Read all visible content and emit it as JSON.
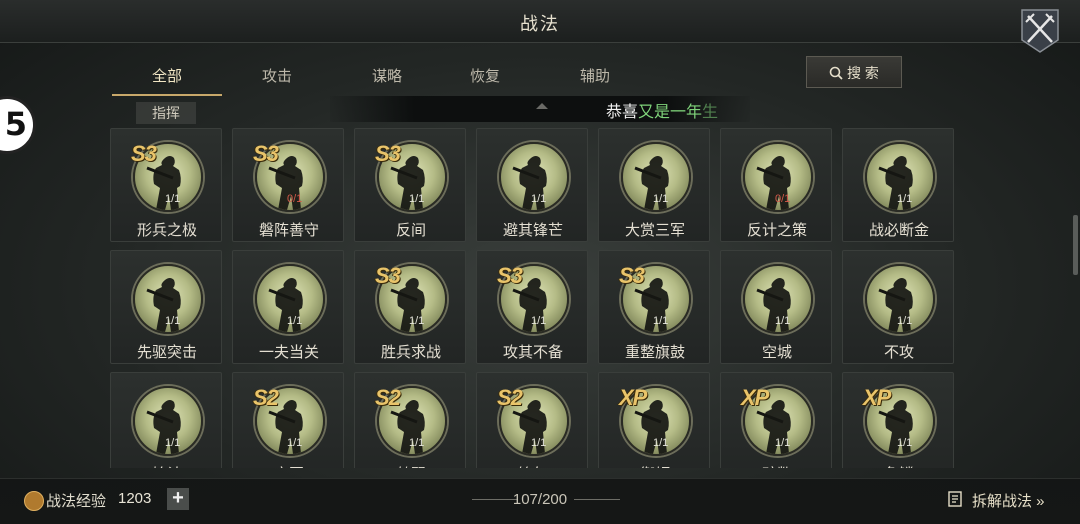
{
  "header": {
    "title": "战法"
  },
  "left_avatar": {
    "text": "5"
  },
  "tabs": [
    {
      "label": "全部",
      "active": true
    },
    {
      "label": "攻击",
      "active": false
    },
    {
      "label": "谋略",
      "active": false
    },
    {
      "label": "恢复",
      "active": false
    },
    {
      "label": "辅助",
      "active": false
    }
  ],
  "subtab": {
    "label": "指挥"
  },
  "search": {
    "label": "搜 索"
  },
  "banner": {
    "text_a": "恭喜",
    "text_b": "又是一年",
    "text_c": "生"
  },
  "cards": [
    {
      "grade": "S3",
      "count": "1/1",
      "count_red": false,
      "name": "形兵之极"
    },
    {
      "grade": "S3",
      "count": "0/1",
      "count_red": true,
      "name": "磐阵善守"
    },
    {
      "grade": "S3",
      "count": "1/1",
      "count_red": false,
      "name": "反间"
    },
    {
      "grade": "",
      "count": "1/1",
      "count_red": false,
      "name": "避其锋芒"
    },
    {
      "grade": "",
      "count": "1/1",
      "count_red": false,
      "name": "大赏三军"
    },
    {
      "grade": "",
      "count": "0/1",
      "count_red": true,
      "name": "反计之策"
    },
    {
      "grade": "",
      "count": "1/1",
      "count_red": false,
      "name": "战必断金"
    },
    {
      "grade": "",
      "count": "1/1",
      "count_red": false,
      "name": "先驱突击"
    },
    {
      "grade": "",
      "count": "1/1",
      "count_red": false,
      "name": "一夫当关"
    },
    {
      "grade": "S3",
      "count": "1/1",
      "count_red": false,
      "name": "胜兵求战"
    },
    {
      "grade": "S3",
      "count": "1/1",
      "count_red": false,
      "name": "攻其不备"
    },
    {
      "grade": "S3",
      "count": "1/1",
      "count_red": false,
      "name": "重整旗鼓"
    },
    {
      "grade": "",
      "count": "1/1",
      "count_red": false,
      "name": "空城"
    },
    {
      "grade": "",
      "count": "1/1",
      "count_red": false,
      "name": "不攻"
    },
    {
      "grade": "",
      "count": "1/1",
      "count_red": false,
      "name": "始计"
    },
    {
      "grade": "S2",
      "count": "1/1",
      "count_red": false,
      "name": "方圆"
    },
    {
      "grade": "S2",
      "count": "1/1",
      "count_red": false,
      "name": "鹤翼"
    },
    {
      "grade": "S2",
      "count": "1/1",
      "count_red": false,
      "name": "锋矢"
    },
    {
      "grade": "XP",
      "count": "1/1",
      "count_red": false,
      "name": "衡轭"
    },
    {
      "grade": "XP",
      "count": "1/1",
      "count_red": false,
      "name": "疏数"
    },
    {
      "grade": "XP",
      "count": "1/1",
      "count_red": false,
      "name": "鱼鳞"
    }
  ],
  "footer": {
    "exp_label": "战法经验",
    "exp_value": "1203",
    "plus_label": "+",
    "page_count": "107/200",
    "dismantle_label": "拆解战法 »"
  },
  "colors": {
    "accent_gold": "#e9c46a",
    "count_red": "#d45a4a",
    "banner_green": "#7fd37a"
  }
}
